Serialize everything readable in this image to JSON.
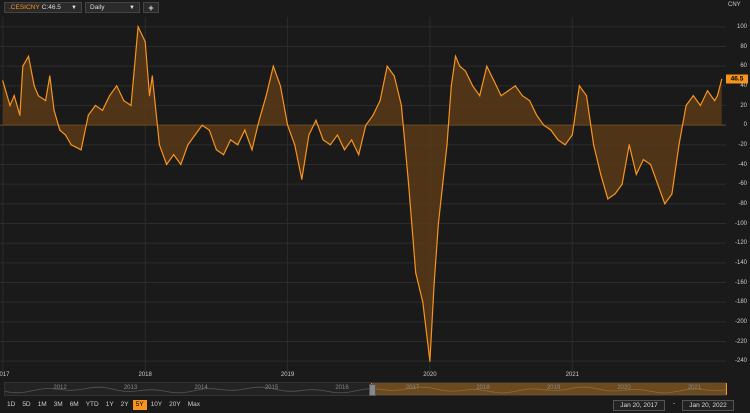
{
  "toolbar": {
    "symbol": ".CESICNY",
    "close_label": "C:46.5",
    "interval": "Daily",
    "add_symbol": "+"
  },
  "axis": {
    "currency": [
      "CNY"
    ],
    "y_ticks": [
      100,
      80,
      60,
      40,
      20,
      0,
      -20,
      -40,
      -60,
      -80,
      -100,
      -120,
      -140,
      -160,
      -180,
      -200,
      -220,
      -240
    ],
    "x_ticks": [
      "2017",
      "2018",
      "2019",
      "2020",
      "2021"
    ],
    "last_value": "46.5"
  },
  "navigator": {
    "labels": [
      "2012",
      "2013",
      "2014",
      "2015",
      "2016",
      "2017",
      "2018",
      "2019",
      "2020",
      "2021"
    ]
  },
  "range_buttons": [
    "1D",
    "5D",
    "1M",
    "3M",
    "6M",
    "YTD",
    "1Y",
    "2Y",
    "5Y",
    "10Y",
    "20Y",
    "Max"
  ],
  "active_range": "5Y",
  "dates": {
    "start": "Jan 20, 2017",
    "end": "Jan 20, 2022"
  },
  "colors": {
    "accent": "#f7941e",
    "fill": "#5a3a17",
    "background": "#1a1a1a"
  },
  "chart_data": {
    "type": "area",
    "ylim": [
      -250,
      110
    ],
    "x": [
      2017.0,
      2017.05,
      2017.08,
      2017.12,
      2017.14,
      2017.18,
      2017.22,
      2017.25,
      2017.3,
      2017.33,
      2017.36,
      2017.4,
      2017.44,
      2017.48,
      2017.55,
      2017.6,
      2017.65,
      2017.7,
      2017.75,
      2017.8,
      2017.85,
      2017.9,
      2017.95,
      2018.0,
      2018.03,
      2018.05,
      2018.1,
      2018.15,
      2018.2,
      2018.25,
      2018.3,
      2018.35,
      2018.4,
      2018.45,
      2018.5,
      2018.55,
      2018.6,
      2018.65,
      2018.7,
      2018.75,
      2018.8,
      2018.85,
      2018.9,
      2018.95,
      2019.0,
      2019.05,
      2019.1,
      2019.15,
      2019.2,
      2019.25,
      2019.3,
      2019.35,
      2019.4,
      2019.45,
      2019.5,
      2019.55,
      2019.6,
      2019.65,
      2019.7,
      2019.75,
      2019.8,
      2019.85,
      2019.9,
      2019.95,
      2020.0,
      2020.03,
      2020.06,
      2020.09,
      2020.12,
      2020.15,
      2020.18,
      2020.21,
      2020.25,
      2020.3,
      2020.35,
      2020.4,
      2020.45,
      2020.5,
      2020.55,
      2020.6,
      2020.65,
      2020.7,
      2020.75,
      2020.8,
      2020.85,
      2020.9,
      2020.95,
      2021.0,
      2021.05,
      2021.1,
      2021.15,
      2021.2,
      2021.25,
      2021.3,
      2021.35,
      2021.4,
      2021.45,
      2021.5,
      2021.55,
      2021.6,
      2021.65,
      2021.7,
      2021.75,
      2021.8,
      2021.85,
      2021.9,
      2021.95,
      2022.0,
      2022.02,
      2022.05
    ],
    "values": [
      45,
      20,
      30,
      10,
      60,
      70,
      40,
      30,
      25,
      50,
      15,
      -5,
      -10,
      -20,
      -25,
      10,
      20,
      15,
      30,
      40,
      25,
      20,
      100,
      85,
      30,
      50,
      -20,
      -40,
      -30,
      -40,
      -20,
      -10,
      0,
      -5,
      -25,
      -30,
      -15,
      -20,
      -5,
      -25,
      5,
      30,
      60,
      40,
      0,
      -20,
      -55,
      -10,
      5,
      -15,
      -20,
      -10,
      -25,
      -15,
      -30,
      0,
      10,
      25,
      60,
      50,
      20,
      -60,
      -150,
      -180,
      -240,
      -160,
      -100,
      -60,
      -20,
      40,
      70,
      60,
      55,
      40,
      30,
      60,
      45,
      30,
      35,
      40,
      30,
      25,
      10,
      0,
      -5,
      -15,
      -20,
      -10,
      40,
      30,
      -20,
      -50,
      -75,
      -70,
      -60,
      -20,
      -50,
      -35,
      -40,
      -60,
      -80,
      -70,
      -20,
      20,
      30,
      20,
      35,
      25,
      30,
      46.5
    ]
  }
}
